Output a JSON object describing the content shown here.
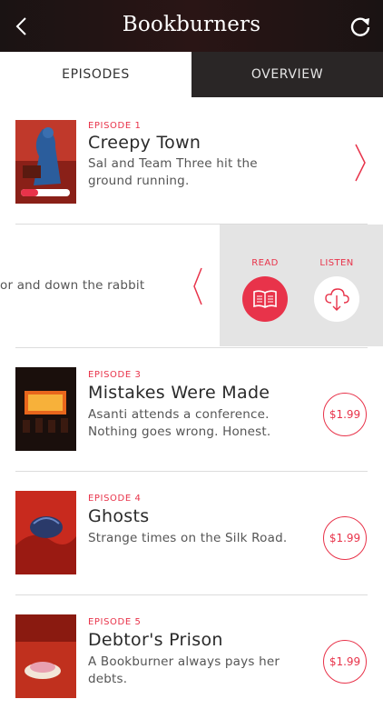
{
  "header": {
    "title": "Bookburners",
    "back_icon": "chevron-left-icon",
    "refresh_icon": "refresh-icon"
  },
  "tabs": [
    {
      "label": "EPISODES",
      "active": true
    },
    {
      "label": "OVERVIEW",
      "active": false
    }
  ],
  "episodes": [
    {
      "label": "EPISODE 1",
      "title": "Creepy Town",
      "desc": "Sal and Team Three hit the ground running.",
      "progress": 0.35
    },
    {
      "swiped_text": "or and down the rabbit",
      "read_label": "READ",
      "listen_label": "LISTEN"
    },
    {
      "label": "EPISODE 3",
      "title": "Mistakes Were Made",
      "desc": "Asanti attends a conference.  Nothing goes wrong.  Honest.",
      "price": "$1.99"
    },
    {
      "label": "EPISODE 4",
      "title": "Ghosts",
      "desc": "Strange times on the Silk Road.",
      "price": "$1.99"
    },
    {
      "label": "EPISODE 5",
      "title": "Debtor's Prison",
      "desc": "A Bookburner always pays her debts.",
      "price": "$1.99"
    }
  ],
  "colors": {
    "accent": "#e8334a",
    "header_bg": "#1a1313",
    "tab_inactive_bg": "#2a2626",
    "action_panel_bg": "#e4e4e4"
  }
}
